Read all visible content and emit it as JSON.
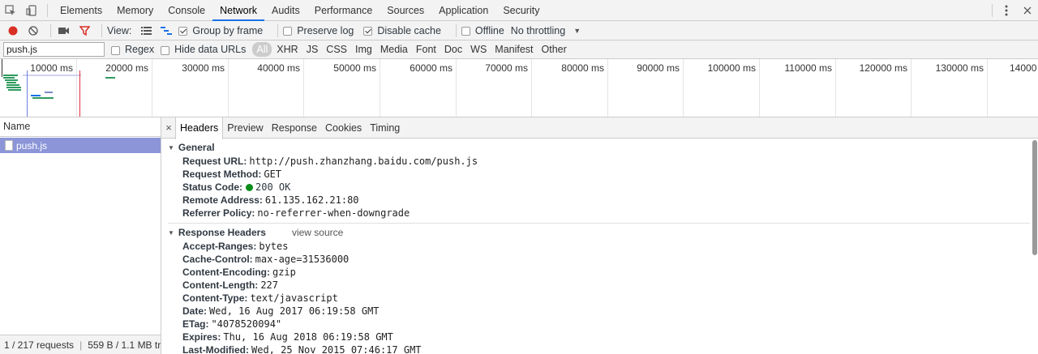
{
  "main_tabs": [
    {
      "label": "Elements"
    },
    {
      "label": "Memory"
    },
    {
      "label": "Console"
    },
    {
      "label": "Network",
      "active": true
    },
    {
      "label": "Audits"
    },
    {
      "label": "Performance"
    },
    {
      "label": "Sources"
    },
    {
      "label": "Application"
    },
    {
      "label": "Security"
    }
  ],
  "toolbar": {
    "view_label": "View:",
    "group_by_frame": "Group by frame",
    "preserve_log": "Preserve log",
    "disable_cache": "Disable cache",
    "offline": "Offline",
    "throttling": "No throttling"
  },
  "filter": {
    "value": "push.js",
    "regex": "Regex",
    "hide_data_urls": "Hide data URLs",
    "types": [
      "All",
      "XHR",
      "JS",
      "CSS",
      "Img",
      "Media",
      "Font",
      "Doc",
      "WS",
      "Manifest",
      "Other"
    ]
  },
  "overview": {
    "ticks": [
      "10000 ms",
      "20000 ms",
      "30000 ms",
      "40000 ms",
      "50000 ms",
      "60000 ms",
      "70000 ms",
      "80000 ms",
      "90000 ms",
      "100000 ms",
      "110000 ms",
      "120000 ms",
      "130000 ms",
      "14000"
    ]
  },
  "request_list": {
    "header": "Name",
    "rows": [
      {
        "name": "push.js",
        "selected": true
      }
    ],
    "footer_requests": "1 / 217 requests",
    "footer_size": "559 B / 1.1 MB tr..."
  },
  "detail_tabs": [
    "Headers",
    "Preview",
    "Response",
    "Cookies",
    "Timing"
  ],
  "general": {
    "title": "General",
    "request_url_k": "Request URL:",
    "request_url_v": "http://push.zhanzhang.baidu.com/push.js",
    "request_method_k": "Request Method:",
    "request_method_v": "GET",
    "status_code_k": "Status Code:",
    "status_code_v": "200 OK",
    "remote_address_k": "Remote Address:",
    "remote_address_v": "61.135.162.21:80",
    "referrer_policy_k": "Referrer Policy:",
    "referrer_policy_v": "no-referrer-when-downgrade"
  },
  "response_headers": {
    "title": "Response Headers",
    "view_source": "view source",
    "items": [
      {
        "k": "Accept-Ranges:",
        "v": "bytes"
      },
      {
        "k": "Cache-Control:",
        "v": "max-age=31536000"
      },
      {
        "k": "Content-Encoding:",
        "v": "gzip"
      },
      {
        "k": "Content-Length:",
        "v": "227"
      },
      {
        "k": "Content-Type:",
        "v": "text/javascript"
      },
      {
        "k": "Date:",
        "v": "Wed, 16 Aug 2017 06:19:58 GMT"
      },
      {
        "k": "ETag:",
        "v": "\"4078520094\""
      },
      {
        "k": "Expires:",
        "v": "Thu, 16 Aug 2018 06:19:58 GMT"
      },
      {
        "k": "Last-Modified:",
        "v": "Wed, 25 Nov 2015 07:46:17 GMT"
      }
    ]
  },
  "colors": {
    "record_red": "#d93025",
    "filter_red": "#d93025",
    "active_blue": "#1a73e8",
    "selected_row": "#8b95d8",
    "status_green": "#0a8c1a"
  }
}
